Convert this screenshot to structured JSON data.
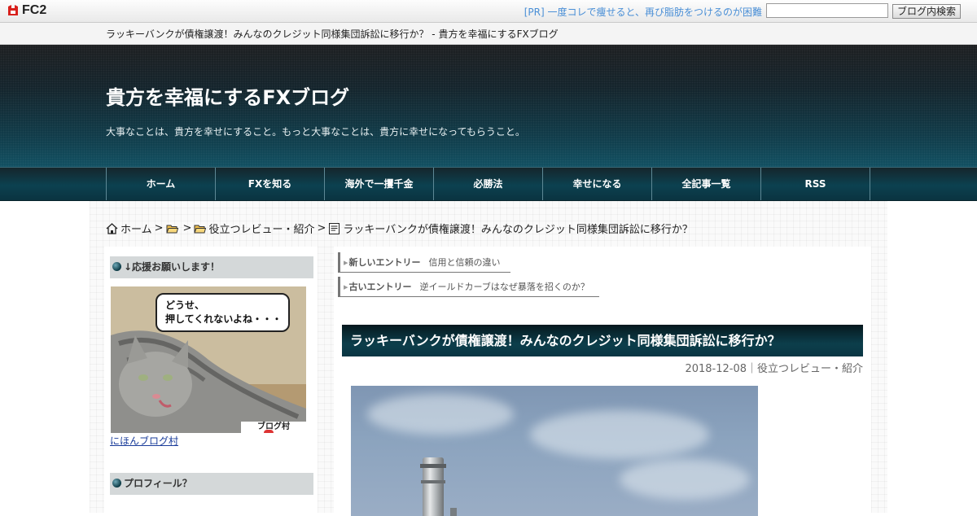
{
  "fc2bar": {
    "logo_text": "FC2",
    "pr_text": "[PR] 一度コレで痩せると、再び脂肪をつけるのが困難",
    "search_placeholder": "",
    "search_button": "ブログ内検索"
  },
  "page_title": "ラッキーバンクが債権譲渡！みんなのクレジット同様集団訴訟に移行か？ - 貴方を幸福にするFXブログ",
  "header": {
    "blog_title": "貴方を幸福にするFXブログ",
    "description": "大事なことは、貴方を幸せにすること。もっと大事なことは、貴方に幸せになってもらうこと。"
  },
  "nav": {
    "items": [
      {
        "label": "ホーム"
      },
      {
        "label": "FXを知る"
      },
      {
        "label": "海外で一攫千金"
      },
      {
        "label": "必勝法"
      },
      {
        "label": "幸せになる"
      },
      {
        "label": "全記事一覧"
      },
      {
        "label": "RSS"
      }
    ]
  },
  "breadcrumb": {
    "home": "ホーム",
    "sep": ">",
    "category": "役立つレビュー・紹介",
    "current": "ラッキーバンクが債権譲渡！みんなのクレジット同様集団訴訟に移行か？"
  },
  "sidebar": {
    "support_heading": "↓応援お願いします！",
    "banner_line1": "どうせ、",
    "banner_line2": "押してくれないよね・・・",
    "banner_tag": "ブログ村",
    "banner_link": "にほんブログ村",
    "profile_heading": "プロフィール？"
  },
  "entries": {
    "newer_label": "新しいエントリー",
    "newer_title": "信用と信頼の違い",
    "older_label": "古いエントリー",
    "older_title": "逆イールドカーブはなぜ暴落を招くのか？"
  },
  "post": {
    "title": "ラッキーバンクが債権譲渡！みんなのクレジット同様集団訴訟に移行か？",
    "meta": "2018-12-08｜役立つレビュー・紹介"
  },
  "colors": {
    "header_dark": "#12222a",
    "header_teal": "#0f4e60",
    "nav_bg": "#0c4150",
    "link_blue": "#1a3c9a",
    "pr_blue": "#4a8fd6"
  },
  "icons": {
    "home": "home-icon",
    "folder": "folder-icon",
    "document": "document-icon",
    "bullet": "bullet-orb-icon"
  }
}
